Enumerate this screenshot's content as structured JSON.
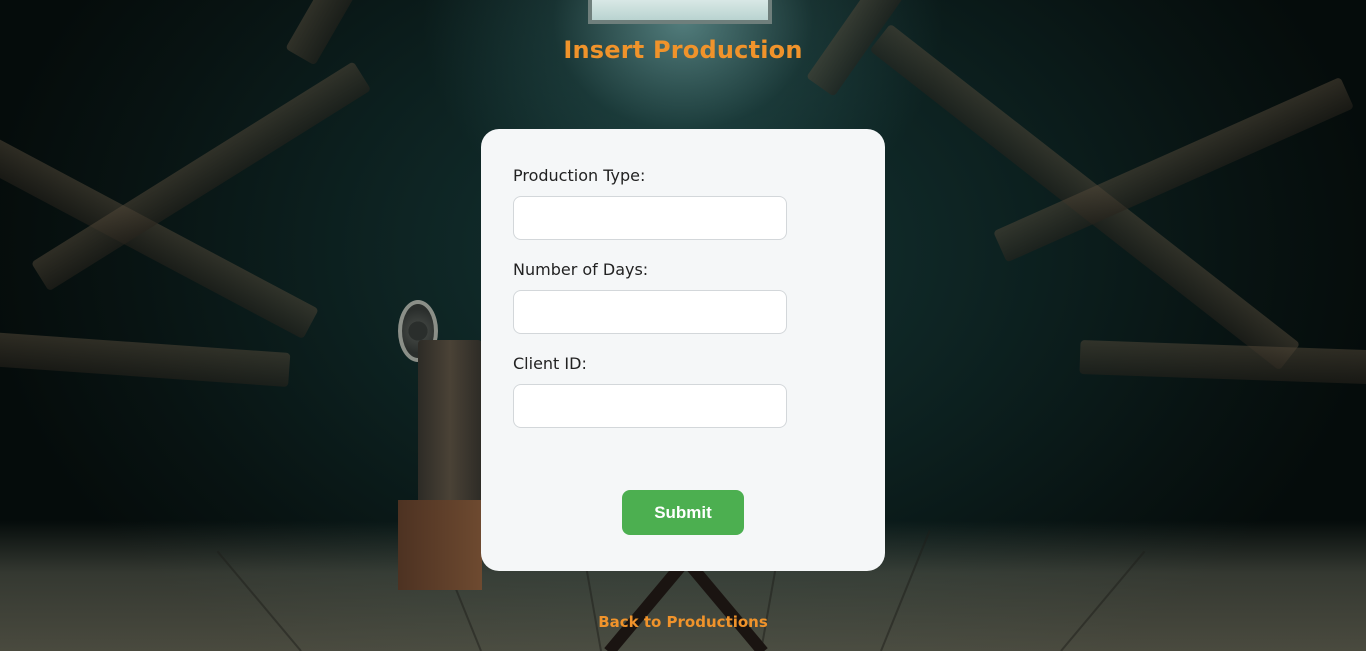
{
  "page": {
    "title": "Insert Production"
  },
  "form": {
    "fields": [
      {
        "label": "Production Type:",
        "value": "",
        "placeholder": ""
      },
      {
        "label": "Number of Days:",
        "value": "",
        "placeholder": ""
      },
      {
        "label": "Client ID:",
        "value": "",
        "placeholder": ""
      }
    ],
    "submit_label": "Submit"
  },
  "footer": {
    "back_link": "Back to Productions"
  },
  "colors": {
    "accent": "#f0932b",
    "submit": "#4caf50",
    "card": "#f5f7f8"
  },
  "icons": {
    "background": "attic-projector-background-image"
  }
}
